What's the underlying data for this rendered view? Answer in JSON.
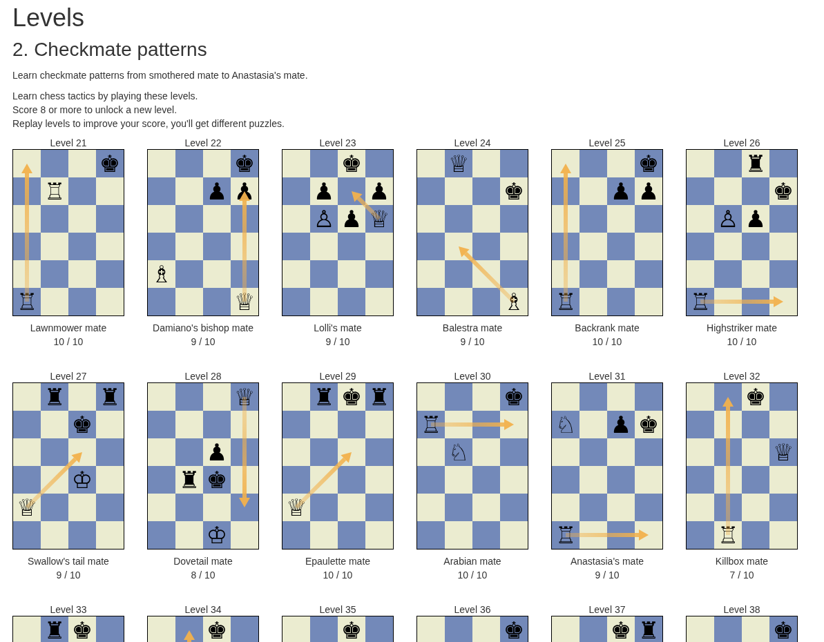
{
  "title": "Levels",
  "subtitle": "2. Checkmate patterns",
  "description": "Learn checkmate patterns from smothered mate to Anastasia's mate.",
  "instructions": [
    "Learn chess tactics by playing these levels.",
    "Score 8 or more to unlock a new level.",
    "Replay levels to improve your score, you'll get different puzzles."
  ],
  "levels": [
    {
      "label": "Level 21",
      "name": "Lawnmower mate",
      "score": "10 / 10",
      "rows": [
        {
          "cells": [
            {
              "kind": "empty",
              "arrow_end": true
            },
            {
              "kind": "empty"
            },
            {
              "kind": "empty"
            },
            {
              "kind": "piece",
              "glyph": "♚"
            }
          ]
        },
        {
          "cells": [
            {
              "kind": "empty"
            },
            {
              "kind": "piece",
              "glyph": "♖"
            },
            {
              "kind": "empty"
            },
            {
              "kind": "empty"
            }
          ]
        },
        {
          "cells": [
            {
              "kind": "empty"
            },
            {
              "kind": "empty"
            },
            {
              "kind": "empty"
            },
            {
              "kind": "empty"
            }
          ]
        },
        {
          "cells": [
            {
              "kind": "empty"
            },
            {
              "kind": "empty"
            },
            {
              "kind": "empty"
            },
            {
              "kind": "empty"
            }
          ]
        },
        {
          "cells": [
            {
              "kind": "empty"
            },
            {
              "kind": "empty"
            },
            {
              "kind": "empty"
            },
            {
              "kind": "empty"
            }
          ]
        },
        {
          "cells": [
            {
              "kind": "piece",
              "glyph": "♖",
              "arrow_start": true
            },
            {
              "kind": "empty"
            },
            {
              "kind": "empty"
            },
            {
              "kind": "empty"
            }
          ]
        }
      ]
    },
    {
      "label": "Level 22",
      "name": "Damiano's bishop mate",
      "score": "9 / 10",
      "rows": [
        {
          "cells": [
            {
              "kind": "empty"
            },
            {
              "kind": "empty"
            },
            {
              "kind": "empty"
            },
            {
              "kind": "piece",
              "glyph": "♚"
            }
          ]
        },
        {
          "cells": [
            {
              "kind": "empty"
            },
            {
              "kind": "empty"
            },
            {
              "kind": "piece",
              "glyph": "♟"
            },
            {
              "kind": "piece",
              "glyph": "♟",
              "arrow_end": true
            }
          ]
        },
        {
          "cells": [
            {
              "kind": "empty"
            },
            {
              "kind": "empty"
            },
            {
              "kind": "empty"
            },
            {
              "kind": "empty"
            }
          ]
        },
        {
          "cells": [
            {
              "kind": "empty"
            },
            {
              "kind": "empty"
            },
            {
              "kind": "empty"
            },
            {
              "kind": "empty"
            }
          ]
        },
        {
          "cells": [
            {
              "kind": "piece",
              "glyph": "♗"
            },
            {
              "kind": "empty"
            },
            {
              "kind": "empty"
            },
            {
              "kind": "empty"
            }
          ]
        },
        {
          "cells": [
            {
              "kind": "empty"
            },
            {
              "kind": "empty"
            },
            {
              "kind": "empty"
            },
            {
              "kind": "piece",
              "glyph": "♕",
              "arrow_start": true
            }
          ]
        }
      ]
    },
    {
      "label": "Level 23",
      "name": "Lolli's mate",
      "score": "9 / 10",
      "rows": [
        {
          "cells": [
            {
              "kind": "empty"
            },
            {
              "kind": "empty"
            },
            {
              "kind": "piece",
              "glyph": "♚"
            },
            {
              "kind": "empty"
            }
          ]
        },
        {
          "cells": [
            {
              "kind": "empty"
            },
            {
              "kind": "piece",
              "glyph": "♟"
            },
            {
              "kind": "empty",
              "arrow_end": true
            },
            {
              "kind": "piece",
              "glyph": "♟"
            }
          ]
        },
        {
          "cells": [
            {
              "kind": "empty"
            },
            {
              "kind": "piece",
              "glyph": "♙"
            },
            {
              "kind": "piece",
              "glyph": "♟"
            },
            {
              "kind": "piece",
              "glyph": "♕",
              "arrow_start": true
            }
          ]
        },
        {
          "cells": [
            {
              "kind": "empty"
            },
            {
              "kind": "empty"
            },
            {
              "kind": "empty"
            },
            {
              "kind": "empty"
            }
          ]
        },
        {
          "cells": [
            {
              "kind": "empty"
            },
            {
              "kind": "empty"
            },
            {
              "kind": "empty"
            },
            {
              "kind": "empty"
            }
          ]
        },
        {
          "cells": [
            {
              "kind": "empty"
            },
            {
              "kind": "empty"
            },
            {
              "kind": "empty"
            },
            {
              "kind": "empty"
            }
          ]
        }
      ]
    },
    {
      "label": "Level 24",
      "name": "Balestra mate",
      "score": "9 / 10",
      "rows": [
        {
          "cells": [
            {
              "kind": "empty"
            },
            {
              "kind": "piece",
              "glyph": "♕"
            },
            {
              "kind": "empty"
            },
            {
              "kind": "empty"
            }
          ]
        },
        {
          "cells": [
            {
              "kind": "empty"
            },
            {
              "kind": "empty"
            },
            {
              "kind": "empty"
            },
            {
              "kind": "piece",
              "glyph": "♚"
            }
          ]
        },
        {
          "cells": [
            {
              "kind": "empty"
            },
            {
              "kind": "empty"
            },
            {
              "kind": "empty"
            },
            {
              "kind": "empty"
            }
          ]
        },
        {
          "cells": [
            {
              "kind": "empty"
            },
            {
              "kind": "empty",
              "arrow_end": true
            },
            {
              "kind": "empty"
            },
            {
              "kind": "empty"
            }
          ]
        },
        {
          "cells": [
            {
              "kind": "empty"
            },
            {
              "kind": "empty"
            },
            {
              "kind": "empty"
            },
            {
              "kind": "empty"
            }
          ]
        },
        {
          "cells": [
            {
              "kind": "empty"
            },
            {
              "kind": "empty"
            },
            {
              "kind": "empty"
            },
            {
              "kind": "piece",
              "glyph": "♗",
              "arrow_start": true
            }
          ]
        }
      ]
    },
    {
      "label": "Level 25",
      "name": "Backrank mate",
      "score": "10 / 10",
      "rows": [
        {
          "cells": [
            {
              "kind": "empty",
              "arrow_end": true
            },
            {
              "kind": "empty"
            },
            {
              "kind": "empty"
            },
            {
              "kind": "piece",
              "glyph": "♚"
            }
          ]
        },
        {
          "cells": [
            {
              "kind": "empty"
            },
            {
              "kind": "empty"
            },
            {
              "kind": "piece",
              "glyph": "♟"
            },
            {
              "kind": "piece",
              "glyph": "♟"
            }
          ]
        },
        {
          "cells": [
            {
              "kind": "empty"
            },
            {
              "kind": "empty"
            },
            {
              "kind": "empty"
            },
            {
              "kind": "empty"
            }
          ]
        },
        {
          "cells": [
            {
              "kind": "empty"
            },
            {
              "kind": "empty"
            },
            {
              "kind": "empty"
            },
            {
              "kind": "empty"
            }
          ]
        },
        {
          "cells": [
            {
              "kind": "empty"
            },
            {
              "kind": "empty"
            },
            {
              "kind": "empty"
            },
            {
              "kind": "empty"
            }
          ]
        },
        {
          "cells": [
            {
              "kind": "piece",
              "glyph": "♖",
              "arrow_start": true
            },
            {
              "kind": "empty"
            },
            {
              "kind": "empty"
            },
            {
              "kind": "empty"
            }
          ]
        }
      ]
    },
    {
      "label": "Level 26",
      "name": "Highstriker mate",
      "score": "10 / 10",
      "rows": [
        {
          "cells": [
            {
              "kind": "empty"
            },
            {
              "kind": "empty"
            },
            {
              "kind": "piece",
              "glyph": "♜"
            },
            {
              "kind": "empty"
            }
          ]
        },
        {
          "cells": [
            {
              "kind": "empty"
            },
            {
              "kind": "empty"
            },
            {
              "kind": "empty"
            },
            {
              "kind": "piece",
              "glyph": "♚"
            }
          ]
        },
        {
          "cells": [
            {
              "kind": "empty"
            },
            {
              "kind": "piece",
              "glyph": "♙"
            },
            {
              "kind": "piece",
              "glyph": "♟"
            },
            {
              "kind": "empty"
            }
          ]
        },
        {
          "cells": [
            {
              "kind": "empty"
            },
            {
              "kind": "empty"
            },
            {
              "kind": "empty"
            },
            {
              "kind": "empty"
            }
          ]
        },
        {
          "cells": [
            {
              "kind": "empty"
            },
            {
              "kind": "empty"
            },
            {
              "kind": "empty"
            },
            {
              "kind": "empty"
            }
          ]
        },
        {
          "cells": [
            {
              "kind": "piece",
              "glyph": "♖",
              "arrow_start": true
            },
            {
              "kind": "empty"
            },
            {
              "kind": "empty"
            },
            {
              "kind": "empty",
              "arrow_end": true
            }
          ]
        }
      ]
    },
    {
      "label": "Level 27",
      "name": "Swallow's tail mate",
      "score": "9 / 10",
      "rows": [
        {
          "cells": [
            {
              "kind": "empty"
            },
            {
              "kind": "piece",
              "glyph": "♜"
            },
            {
              "kind": "empty"
            },
            {
              "kind": "piece",
              "glyph": "♜"
            }
          ]
        },
        {
          "cells": [
            {
              "kind": "empty"
            },
            {
              "kind": "empty"
            },
            {
              "kind": "piece",
              "glyph": "♚"
            },
            {
              "kind": "empty"
            }
          ]
        },
        {
          "cells": [
            {
              "kind": "empty"
            },
            {
              "kind": "empty"
            },
            {
              "kind": "empty",
              "arrow_end": true
            },
            {
              "kind": "empty"
            }
          ]
        },
        {
          "cells": [
            {
              "kind": "empty"
            },
            {
              "kind": "empty"
            },
            {
              "kind": "piece",
              "glyph": "♔"
            },
            {
              "kind": "empty"
            }
          ]
        },
        {
          "cells": [
            {
              "kind": "piece",
              "glyph": "♕",
              "arrow_start": true
            },
            {
              "kind": "empty"
            },
            {
              "kind": "empty"
            },
            {
              "kind": "empty"
            }
          ]
        },
        {
          "cells": [
            {
              "kind": "empty"
            },
            {
              "kind": "empty"
            },
            {
              "kind": "empty"
            },
            {
              "kind": "empty"
            }
          ]
        }
      ]
    },
    {
      "label": "Level 28",
      "name": "Dovetail mate",
      "score": "8 / 10",
      "rows": [
        {
          "cells": [
            {
              "kind": "empty"
            },
            {
              "kind": "empty"
            },
            {
              "kind": "empty"
            },
            {
              "kind": "piece",
              "glyph": "♕",
              "arrow_start": true
            }
          ]
        },
        {
          "cells": [
            {
              "kind": "empty"
            },
            {
              "kind": "empty"
            },
            {
              "kind": "empty"
            },
            {
              "kind": "empty"
            }
          ]
        },
        {
          "cells": [
            {
              "kind": "empty"
            },
            {
              "kind": "empty"
            },
            {
              "kind": "piece",
              "glyph": "♟"
            },
            {
              "kind": "empty"
            }
          ]
        },
        {
          "cells": [
            {
              "kind": "empty"
            },
            {
              "kind": "piece",
              "glyph": "♜"
            },
            {
              "kind": "piece",
              "glyph": "♚"
            },
            {
              "kind": "empty"
            }
          ]
        },
        {
          "cells": [
            {
              "kind": "empty"
            },
            {
              "kind": "empty"
            },
            {
              "kind": "empty"
            },
            {
              "kind": "empty",
              "arrow_end": true
            }
          ]
        },
        {
          "cells": [
            {
              "kind": "empty"
            },
            {
              "kind": "empty"
            },
            {
              "kind": "piece",
              "glyph": "♔"
            },
            {
              "kind": "empty"
            }
          ]
        }
      ]
    },
    {
      "label": "Level 29",
      "name": "Epaulette mate",
      "score": "10 / 10",
      "rows": [
        {
          "cells": [
            {
              "kind": "empty"
            },
            {
              "kind": "piece",
              "glyph": "♜"
            },
            {
              "kind": "piece",
              "glyph": "♚"
            },
            {
              "kind": "piece",
              "glyph": "♜"
            }
          ]
        },
        {
          "cells": [
            {
              "kind": "empty"
            },
            {
              "kind": "empty"
            },
            {
              "kind": "empty"
            },
            {
              "kind": "empty"
            }
          ]
        },
        {
          "cells": [
            {
              "kind": "empty"
            },
            {
              "kind": "empty"
            },
            {
              "kind": "empty",
              "arrow_end": true
            },
            {
              "kind": "empty"
            }
          ]
        },
        {
          "cells": [
            {
              "kind": "empty"
            },
            {
              "kind": "empty"
            },
            {
              "kind": "empty"
            },
            {
              "kind": "empty"
            }
          ]
        },
        {
          "cells": [
            {
              "kind": "piece",
              "glyph": "♕",
              "arrow_start": true
            },
            {
              "kind": "empty"
            },
            {
              "kind": "empty"
            },
            {
              "kind": "empty"
            }
          ]
        },
        {
          "cells": [
            {
              "kind": "empty"
            },
            {
              "kind": "empty"
            },
            {
              "kind": "empty"
            },
            {
              "kind": "empty"
            }
          ]
        }
      ]
    },
    {
      "label": "Level 30",
      "name": "Arabian mate",
      "score": "10 / 10",
      "rows": [
        {
          "cells": [
            {
              "kind": "empty"
            },
            {
              "kind": "empty"
            },
            {
              "kind": "empty"
            },
            {
              "kind": "piece",
              "glyph": "♚"
            }
          ]
        },
        {
          "cells": [
            {
              "kind": "piece",
              "glyph": "♖",
              "arrow_start": true
            },
            {
              "kind": "empty"
            },
            {
              "kind": "empty"
            },
            {
              "kind": "empty",
              "arrow_end": true
            }
          ]
        },
        {
          "cells": [
            {
              "kind": "empty"
            },
            {
              "kind": "piece",
              "glyph": "♘"
            },
            {
              "kind": "empty"
            },
            {
              "kind": "empty"
            }
          ]
        },
        {
          "cells": [
            {
              "kind": "empty"
            },
            {
              "kind": "empty"
            },
            {
              "kind": "empty"
            },
            {
              "kind": "empty"
            }
          ]
        },
        {
          "cells": [
            {
              "kind": "empty"
            },
            {
              "kind": "empty"
            },
            {
              "kind": "empty"
            },
            {
              "kind": "empty"
            }
          ]
        },
        {
          "cells": [
            {
              "kind": "empty"
            },
            {
              "kind": "empty"
            },
            {
              "kind": "empty"
            },
            {
              "kind": "empty"
            }
          ]
        }
      ]
    },
    {
      "label": "Level 31",
      "name": "Anastasia's mate",
      "score": "9 / 10",
      "rows": [
        {
          "cells": [
            {
              "kind": "empty"
            },
            {
              "kind": "empty"
            },
            {
              "kind": "empty"
            },
            {
              "kind": "empty"
            }
          ]
        },
        {
          "cells": [
            {
              "kind": "piece",
              "glyph": "♘"
            },
            {
              "kind": "empty"
            },
            {
              "kind": "piece",
              "glyph": "♟"
            },
            {
              "kind": "piece",
              "glyph": "♚"
            }
          ]
        },
        {
          "cells": [
            {
              "kind": "empty"
            },
            {
              "kind": "empty"
            },
            {
              "kind": "empty"
            },
            {
              "kind": "empty"
            }
          ]
        },
        {
          "cells": [
            {
              "kind": "empty"
            },
            {
              "kind": "empty"
            },
            {
              "kind": "empty"
            },
            {
              "kind": "empty"
            }
          ]
        },
        {
          "cells": [
            {
              "kind": "empty"
            },
            {
              "kind": "empty"
            },
            {
              "kind": "empty"
            },
            {
              "kind": "empty"
            }
          ]
        },
        {
          "cells": [
            {
              "kind": "piece",
              "glyph": "♖",
              "arrow_start": true
            },
            {
              "kind": "empty"
            },
            {
              "kind": "empty"
            },
            {
              "kind": "empty",
              "arrow_end": true
            }
          ]
        }
      ]
    },
    {
      "label": "Level 32",
      "name": "Killbox mate",
      "score": "7 / 10",
      "rows": [
        {
          "cells": [
            {
              "kind": "empty"
            },
            {
              "kind": "empty",
              "arrow_end": true
            },
            {
              "kind": "piece",
              "glyph": "♚"
            },
            {
              "kind": "empty"
            }
          ]
        },
        {
          "cells": [
            {
              "kind": "empty"
            },
            {
              "kind": "empty"
            },
            {
              "kind": "empty"
            },
            {
              "kind": "empty"
            }
          ]
        },
        {
          "cells": [
            {
              "kind": "empty"
            },
            {
              "kind": "empty"
            },
            {
              "kind": "empty"
            },
            {
              "kind": "piece",
              "glyph": "♕"
            }
          ]
        },
        {
          "cells": [
            {
              "kind": "empty"
            },
            {
              "kind": "empty"
            },
            {
              "kind": "empty"
            },
            {
              "kind": "empty"
            }
          ]
        },
        {
          "cells": [
            {
              "kind": "empty"
            },
            {
              "kind": "empty"
            },
            {
              "kind": "empty"
            },
            {
              "kind": "empty"
            }
          ]
        },
        {
          "cells": [
            {
              "kind": "empty"
            },
            {
              "kind": "piece",
              "glyph": "♖",
              "arrow_start": true
            },
            {
              "kind": "empty"
            },
            {
              "kind": "empty"
            }
          ]
        }
      ]
    },
    {
      "label": "Level 33",
      "rows": [
        {
          "cells": [
            {
              "kind": "empty"
            },
            {
              "kind": "piece",
              "glyph": "♜"
            },
            {
              "kind": "piece",
              "glyph": "♚"
            },
            {
              "kind": "empty"
            }
          ]
        }
      ]
    },
    {
      "label": "Level 34",
      "rows": [
        {
          "cells": [
            {
              "kind": "empty"
            },
            {
              "kind": "empty",
              "arrow_end": true
            },
            {
              "kind": "piece",
              "glyph": "♚"
            },
            {
              "kind": "empty"
            }
          ]
        }
      ]
    },
    {
      "label": "Level 35",
      "rows": [
        {
          "cells": [
            {
              "kind": "empty"
            },
            {
              "kind": "empty"
            },
            {
              "kind": "piece",
              "glyph": "♚"
            },
            {
              "kind": "empty"
            }
          ]
        }
      ]
    },
    {
      "label": "Level 36",
      "rows": [
        {
          "cells": [
            {
              "kind": "empty"
            },
            {
              "kind": "empty"
            },
            {
              "kind": "empty"
            },
            {
              "kind": "piece",
              "glyph": "♚"
            }
          ]
        }
      ]
    },
    {
      "label": "Level 37",
      "rows": [
        {
          "cells": [
            {
              "kind": "empty"
            },
            {
              "kind": "empty"
            },
            {
              "kind": "piece",
              "glyph": "♚"
            },
            {
              "kind": "piece",
              "glyph": "♜"
            }
          ]
        }
      ]
    },
    {
      "label": "Level 38",
      "rows": [
        {
          "cells": [
            {
              "kind": "empty"
            },
            {
              "kind": "empty"
            },
            {
              "kind": "empty"
            },
            {
              "kind": "piece",
              "glyph": "♚"
            }
          ]
        }
      ]
    }
  ]
}
